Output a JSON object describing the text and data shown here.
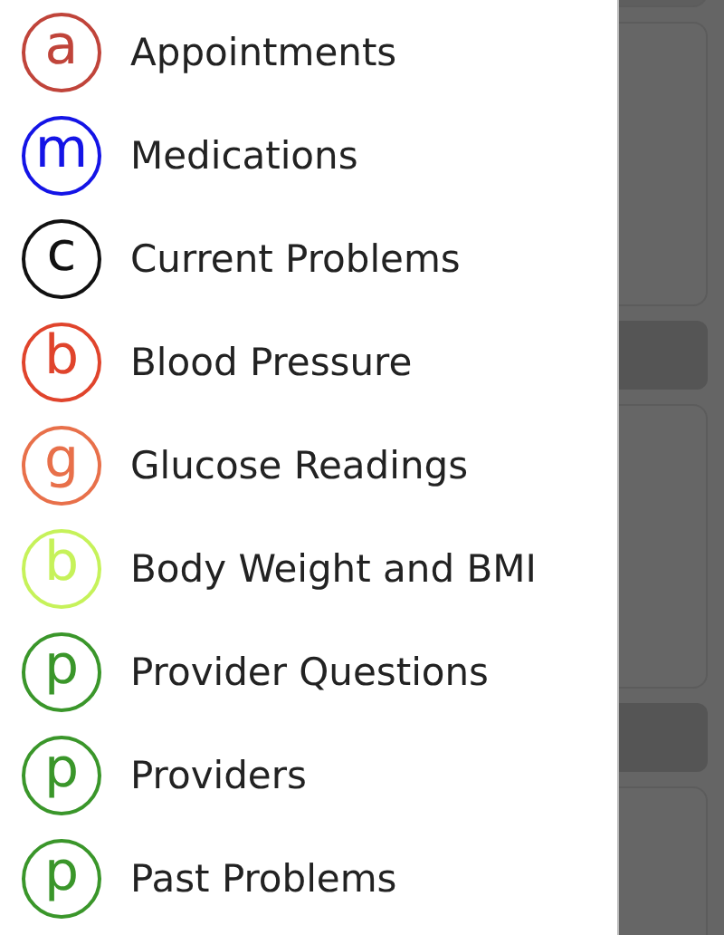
{
  "menu": {
    "items": [
      {
        "letter": "a",
        "label": "Appointments",
        "color": "#c0443a"
      },
      {
        "letter": "m",
        "label": "Medications",
        "color": "#1414e6"
      },
      {
        "letter": "c",
        "label": "Current Problems",
        "color": "#111111"
      },
      {
        "letter": "b",
        "label": "Blood Pressure",
        "color": "#e0442c"
      },
      {
        "letter": "g",
        "label": "Glucose Readings",
        "color": "#e8704a"
      },
      {
        "letter": "b",
        "label": "Body Weight and BMI",
        "color": "#c6f25a"
      },
      {
        "letter": "p",
        "label": "Provider Questions",
        "color": "#3a962a"
      },
      {
        "letter": "p",
        "label": "Providers",
        "color": "#3a962a"
      },
      {
        "letter": "p",
        "label": "Past Problems",
        "color": "#3a962a"
      }
    ]
  }
}
